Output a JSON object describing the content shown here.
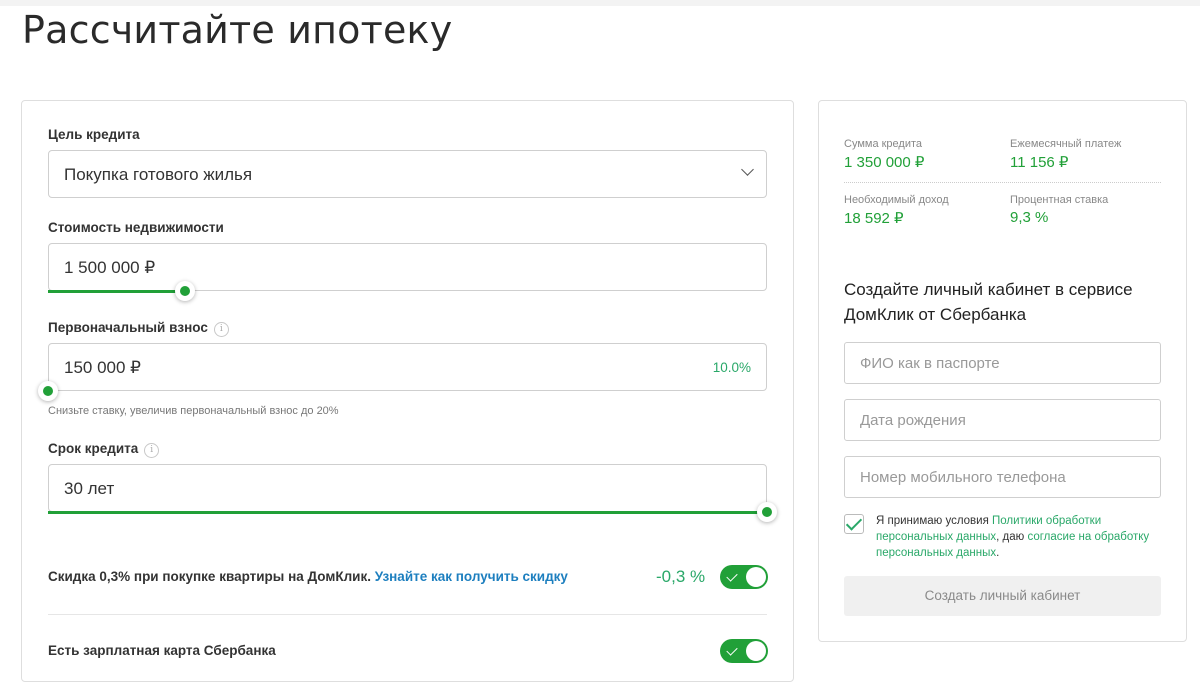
{
  "page": {
    "title": "Рассчитайте ипотеку"
  },
  "form": {
    "purpose": {
      "label": "Цель кредита",
      "value": "Покупка готового жилья"
    },
    "price": {
      "label": "Стоимость недвижимости",
      "value": "1 500 000 ₽",
      "slider_fraction": 0.19
    },
    "down_payment": {
      "label": "Первоначальный взнос",
      "info": "i",
      "value": "150 000 ₽",
      "percent": "10.0%",
      "slider_fraction": 0.0,
      "hint": "Снизьте ставку, увеличив первоначальный взнос до 20%"
    },
    "term": {
      "label": "Срок кредита",
      "info": "i",
      "value": "30 лет",
      "slider_fraction": 1.0
    },
    "discount": {
      "text": "Скидка 0,3% при покупке квартиры на ДомКлик. ",
      "link": "Узнайте как получить скидку",
      "value": "-0,3 %",
      "enabled": true
    },
    "salary_card": {
      "text": "Есть зарплатная карта Сбербанка",
      "enabled": true
    }
  },
  "summary": {
    "loan_amount": {
      "label": "Сумма кредита",
      "value": "1 350 000 ₽"
    },
    "monthly_payment": {
      "label": "Ежемесячный платеж",
      "value": "11 156 ₽"
    },
    "required_income": {
      "label": "Необходимый доход",
      "value": "18 592 ₽"
    },
    "interest_rate": {
      "label": "Процентная ставка",
      "value": "9,3 %"
    }
  },
  "signup": {
    "title": "Создайте личный кабинет в сервисе ДомКлик от Сбербанка",
    "name_placeholder": "ФИО как в паспорте",
    "dob_placeholder": "Дата рождения",
    "phone_placeholder": "Номер мобильного телефона",
    "consent_checked": true,
    "consent_1": "Я принимаю условия ",
    "consent_link1": "Политики обработки персональных данных",
    "consent_2": ", даю ",
    "consent_link2": "согласие на обработку персональных данных",
    "consent_3": ".",
    "submit": "Создать личный кабинет"
  },
  "colors": {
    "accent": "#21a038",
    "accent_text": "#2aa869",
    "link": "#1d7fbf"
  }
}
